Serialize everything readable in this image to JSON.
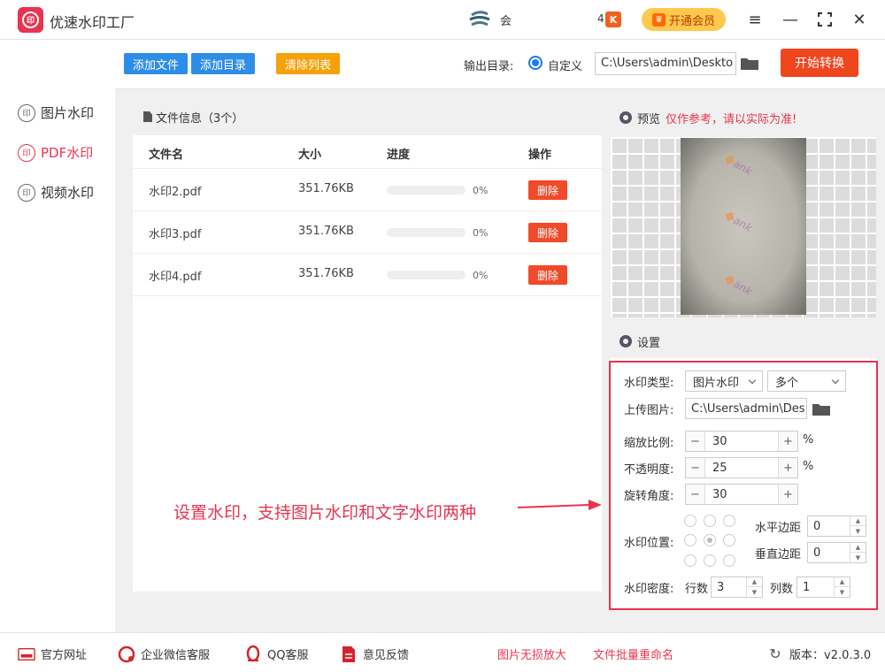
{
  "titlebar": {
    "app_title": "优速水印工厂",
    "logo_glyph": "印",
    "user_name": "会",
    "coupon_count": "4",
    "coupon_glyph": "K",
    "vip_label": "开通会员"
  },
  "sidebar": {
    "items": [
      {
        "label": "图片水印",
        "glyph": "印"
      },
      {
        "label": "PDF水印",
        "glyph": "印"
      },
      {
        "label": "视频水印",
        "glyph": "印"
      }
    ]
  },
  "toolbar": {
    "add_file": "添加文件",
    "add_dir": "添加目录",
    "clear_list": "清除列表",
    "output_label": "输出目录:",
    "radio_label": "自定义",
    "output_path": "C:\\Users\\admin\\Deskto",
    "start_label": "开始转换",
    "colors": {
      "blue": "#2e8de6",
      "orange": "#f5a20a",
      "start": "#f0461e"
    }
  },
  "file_panel": {
    "header": "文件信息（3个）",
    "columns": {
      "name": "文件名",
      "size": "大小",
      "progress": "进度",
      "action": "操作"
    },
    "rows": [
      {
        "name": "水印2.pdf",
        "size": "351.76KB",
        "pct": "0%",
        "action": "删除",
        "progress": 0
      },
      {
        "name": "水印3.pdf",
        "size": "351.76KB",
        "pct": "0%",
        "action": "删除",
        "progress": 0
      },
      {
        "name": "水印4.pdf",
        "size": "351.76KB",
        "pct": "0%",
        "action": "删除",
        "progress": 0
      }
    ]
  },
  "annotation": "设置水印，支持图片水印和文字水印两种",
  "preview": {
    "title": "预览",
    "warning": "仅作参考，请以实际为准!",
    "watermark_text": "ank"
  },
  "settings": {
    "title": "设置",
    "wm_type_label": "水印类型:",
    "wm_type_value": "图片水印",
    "wm_count_value": "多个",
    "upload_label": "上传图片:",
    "upload_path": "C:\\Users\\admin\\Des",
    "scale_label": "缩放比例:",
    "scale_value": "30",
    "scale_unit": "%",
    "opacity_label": "不透明度:",
    "opacity_value": "25",
    "opacity_unit": "%",
    "rotate_label": "旋转角度:",
    "rotate_value": "30",
    "position_label": "水印位置:",
    "h_margin_label": "水平边距",
    "h_margin_value": "0",
    "v_margin_label": "垂直边距",
    "v_margin_value": "0",
    "density_label": "水印密度:",
    "rows_label": "行数",
    "rows_value": "3",
    "cols_label": "列数",
    "cols_value": "1",
    "minus": "−",
    "plus": "+"
  },
  "footer": {
    "website": "官方网址",
    "wechat": "企业微信客服",
    "qq": "QQ客服",
    "feedback": "意见反馈",
    "link1": "图片无损放大",
    "link2": "文件批量重命名",
    "version": "版本：v2.0.3.0"
  }
}
